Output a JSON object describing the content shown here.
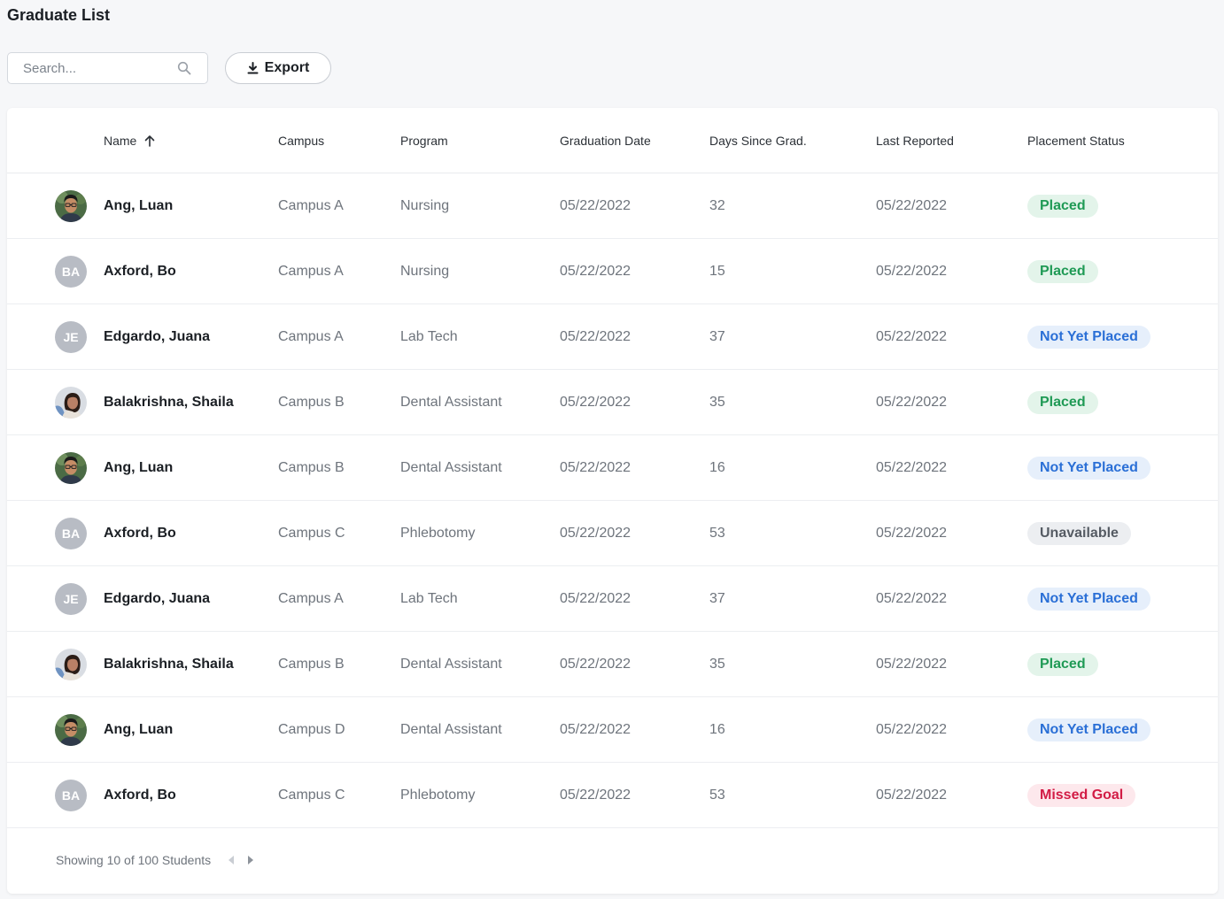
{
  "page": {
    "title": "Graduate List"
  },
  "search": {
    "placeholder": "Search..."
  },
  "toolbar": {
    "export_label": "Export"
  },
  "table": {
    "columns": [
      {
        "key": "name",
        "label": "Name",
        "sorted": "asc"
      },
      {
        "key": "campus",
        "label": "Campus"
      },
      {
        "key": "program",
        "label": "Program"
      },
      {
        "key": "graduation_date",
        "label": "Graduation Date"
      },
      {
        "key": "days_since_grad",
        "label": "Days Since Grad."
      },
      {
        "key": "last_reported",
        "label": "Last Reported"
      },
      {
        "key": "placement_status",
        "label": "Placement Status"
      }
    ],
    "rows": [
      {
        "avatar": "photo-man-glasses",
        "initials": "",
        "name": "Ang, Luan",
        "campus": "Campus A",
        "program": "Nursing",
        "graduation_date": "05/22/2022",
        "days": "32",
        "last_reported": "05/22/2022",
        "status": "Placed"
      },
      {
        "avatar": "initials",
        "initials": "BA",
        "name": "Axford, Bo",
        "campus": "Campus A",
        "program": "Nursing",
        "graduation_date": "05/22/2022",
        "days": "15",
        "last_reported": "05/22/2022",
        "status": "Placed"
      },
      {
        "avatar": "initials",
        "initials": "JE",
        "name": "Edgardo, Juana",
        "campus": "Campus A",
        "program": "Lab Tech",
        "graduation_date": "05/22/2022",
        "days": "37",
        "last_reported": "05/22/2022",
        "status": "Not Yet Placed"
      },
      {
        "avatar": "photo-woman",
        "initials": "",
        "name": "Balakrishna, Shaila",
        "campus": "Campus B",
        "program": "Dental Assistant",
        "graduation_date": "05/22/2022",
        "days": "35",
        "last_reported": "05/22/2022",
        "status": "Placed"
      },
      {
        "avatar": "photo-man-glasses",
        "initials": "",
        "name": "Ang, Luan",
        "campus": "Campus B",
        "program": "Dental Assistant",
        "graduation_date": "05/22/2022",
        "days": "16",
        "last_reported": "05/22/2022",
        "status": "Not Yet Placed"
      },
      {
        "avatar": "initials",
        "initials": "BA",
        "name": "Axford, Bo",
        "campus": "Campus C",
        "program": "Phlebotomy",
        "graduation_date": "05/22/2022",
        "days": "53",
        "last_reported": "05/22/2022",
        "status": "Unavailable"
      },
      {
        "avatar": "initials",
        "initials": "JE",
        "name": "Edgardo, Juana",
        "campus": "Campus A",
        "program": "Lab Tech",
        "graduation_date": "05/22/2022",
        "days": "37",
        "last_reported": "05/22/2022",
        "status": "Not Yet Placed"
      },
      {
        "avatar": "photo-woman",
        "initials": "",
        "name": "Balakrishna, Shaila",
        "campus": "Campus B",
        "program": "Dental Assistant",
        "graduation_date": "05/22/2022",
        "days": "35",
        "last_reported": "05/22/2022",
        "status": "Placed"
      },
      {
        "avatar": "photo-man-glasses",
        "initials": "",
        "name": "Ang, Luan",
        "campus": "Campus D",
        "program": "Dental Assistant",
        "graduation_date": "05/22/2022",
        "days": "16",
        "last_reported": "05/22/2022",
        "status": "Not Yet Placed"
      },
      {
        "avatar": "initials",
        "initials": "BA",
        "name": "Axford, Bo",
        "campus": "Campus C",
        "program": "Phlebotomy",
        "graduation_date": "05/22/2022",
        "days": "53",
        "last_reported": "05/22/2022",
        "status": "Missed Goal"
      }
    ]
  },
  "status_colors": {
    "Placed": {
      "bg": "#e3f4ea",
      "fg": "#1f9a55"
    },
    "Not Yet Placed": {
      "bg": "#e6effb",
      "fg": "#2a6fd6"
    },
    "Unavailable": {
      "bg": "#eceef1",
      "fg": "#555b63"
    },
    "Missed Goal": {
      "bg": "#fde8ec",
      "fg": "#d21c45"
    }
  },
  "footer": {
    "summary": "Showing 10 of 100 Students"
  },
  "icons": {
    "search": "search-icon",
    "export": "download-icon",
    "sort": "arrow-up-icon",
    "prev": "chevron-left-icon",
    "next": "chevron-right-icon"
  }
}
